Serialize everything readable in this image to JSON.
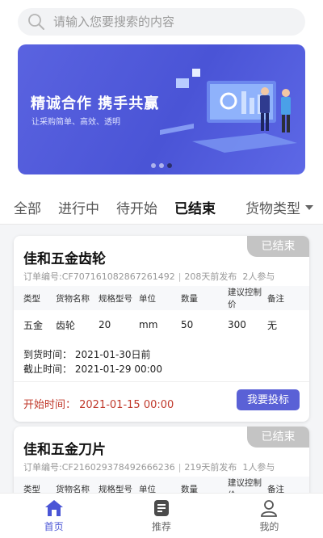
{
  "search": {
    "placeholder": "请输入您要搜索的内容"
  },
  "banner": {
    "title": "精诚合作  携手共赢",
    "subtitle": "让采购简单、高效、透明",
    "active_dot": 3
  },
  "tabs": [
    {
      "label": "全部",
      "active": false
    },
    {
      "label": "进行中",
      "active": false
    },
    {
      "label": "待开始",
      "active": false
    },
    {
      "label": "已结束",
      "active": true
    }
  ],
  "filter": {
    "label": "货物类型"
  },
  "table_headers": [
    "类型",
    "货物名称",
    "规格型号",
    "单位",
    "数量",
    "建议控制价",
    "备注"
  ],
  "orders": [
    {
      "status": "已结束",
      "title": "佳和五金齿轮",
      "order_no": "订单编号:CF707161082867261492",
      "published": "208天前发布",
      "participants": "2人参与",
      "row": [
        "五金",
        "齿轮",
        "20",
        "mm",
        "50",
        "300",
        "无"
      ],
      "arrival": "到货时间：  2021-01-30日前",
      "deadline": "截止时间：  2021-01-29 00:00",
      "start": "开始时间：  2021-01-15 00:00",
      "action": "我要投标"
    },
    {
      "status": "已结束",
      "title": "佳和五金刀片",
      "order_no": "订单编号:CF216029378492666236",
      "published": "219天前发布",
      "participants": "1人参与"
    }
  ],
  "nav": [
    {
      "label": "首页",
      "icon": "home-icon",
      "active": true
    },
    {
      "label": "推荐",
      "icon": "list-icon",
      "active": false
    },
    {
      "label": "我的",
      "icon": "user-icon",
      "active": false
    }
  ],
  "colors": {
    "accent": "#5a61d6",
    "banner": "#5058dc",
    "badge": "#c4c4c4",
    "start_time": "#c0392b"
  }
}
